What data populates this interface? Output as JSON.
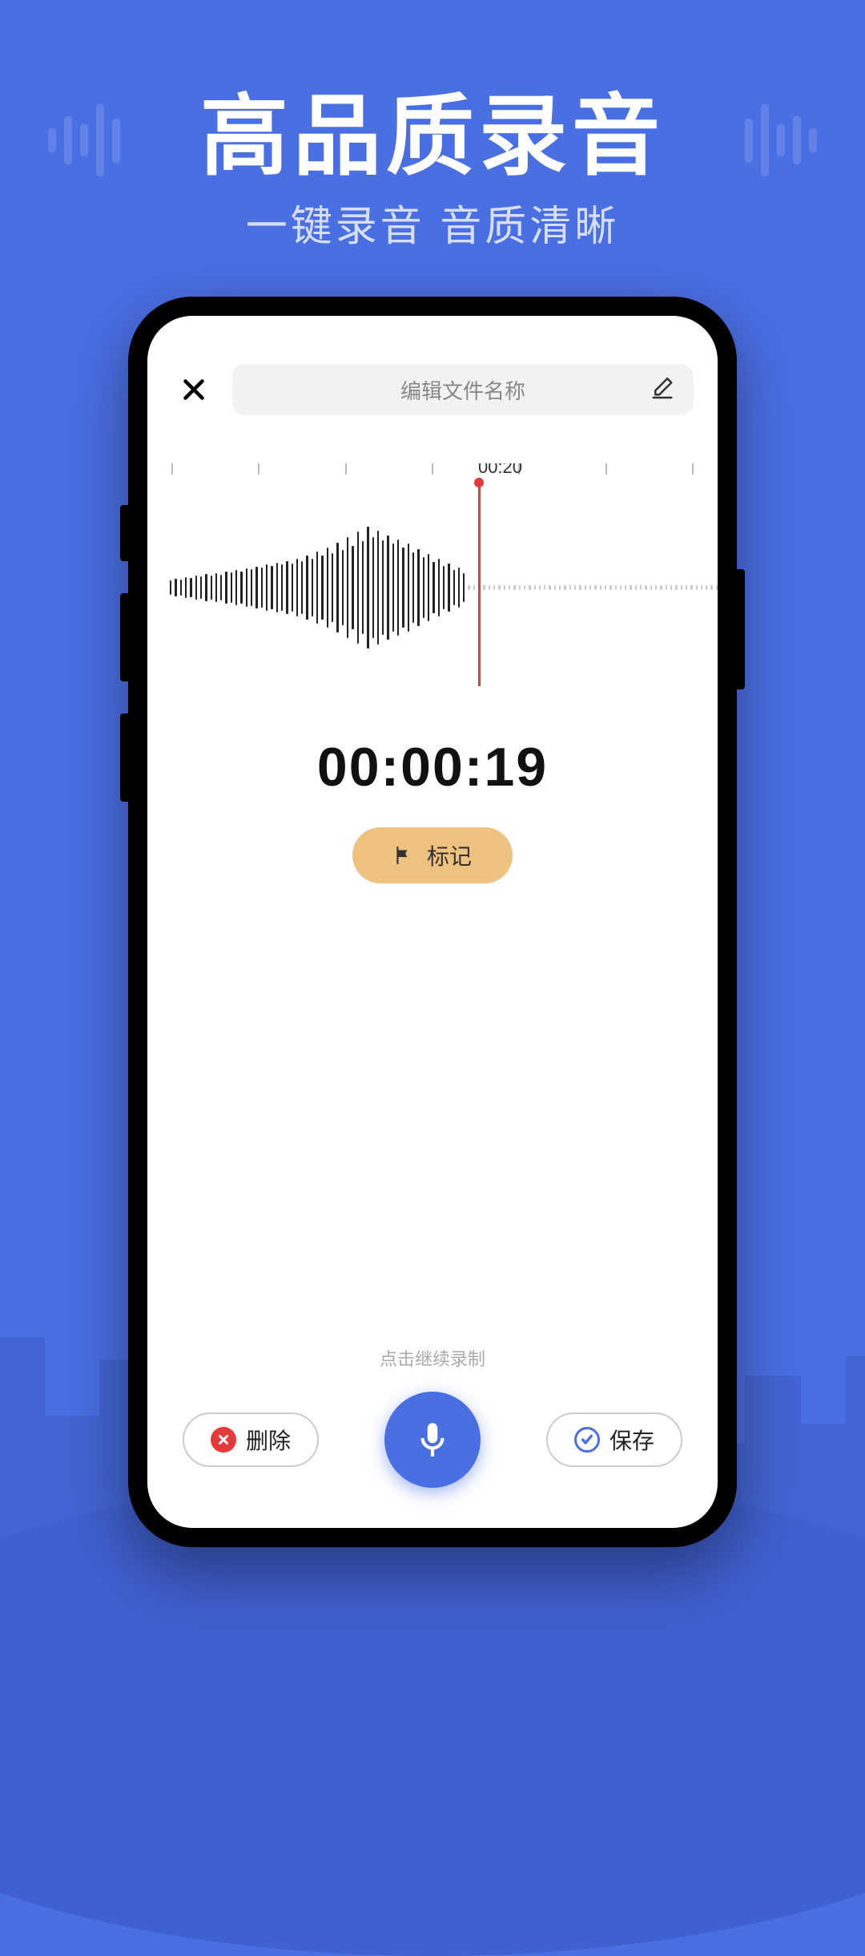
{
  "hero": {
    "title": "高品质录音",
    "subtitle": "一键录音 音质清晰"
  },
  "topbar": {
    "filename_placeholder": "编辑文件名称"
  },
  "waveform": {
    "playhead_label": "00:20"
  },
  "timer": {
    "value": "00:00:19"
  },
  "mark": {
    "label": "标记"
  },
  "hint": {
    "text": "点击继续录制"
  },
  "controls": {
    "delete_label": "删除",
    "save_label": "保存"
  }
}
